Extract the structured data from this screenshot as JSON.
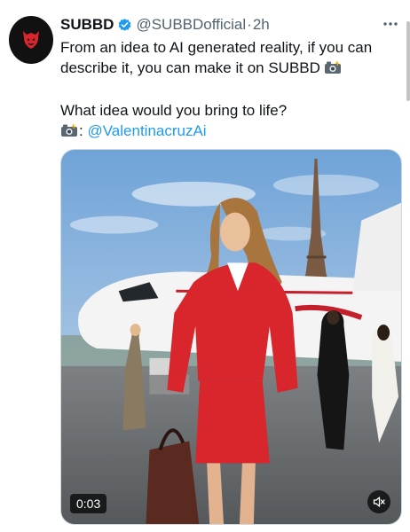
{
  "author": {
    "name": "SUBBD",
    "handle": "@SUBBDofficial",
    "separator": "·",
    "time": "2h",
    "verified_icon": "verified-badge-icon",
    "avatar_icon": "subbd-devil-logo"
  },
  "tweet": {
    "line1": "From an idea to AI generated reality, if you can",
    "line2": "describe it, you can make it on SUBBD",
    "line3": "What idea would you bring to life?",
    "camera_label_suffix": ":",
    "mention": "@ValentinacruzAi",
    "camera_icon": "camera-flash-emoji"
  },
  "media": {
    "duration": "0:03",
    "mute_icon": "speaker-muted-icon"
  },
  "colors": {
    "accent": "#1d9bf0",
    "text": "#0f1419",
    "secondary": "#536471",
    "avatar_bg": "#111111",
    "logo_red": "#d8262c"
  }
}
